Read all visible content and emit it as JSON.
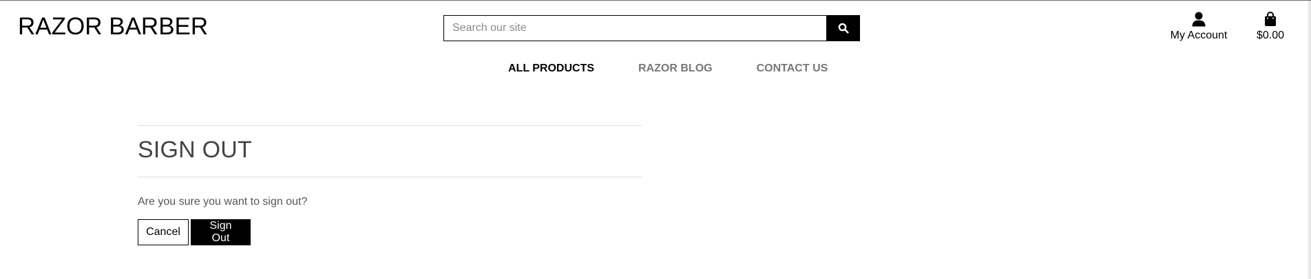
{
  "brand": {
    "name": "RAZOR BARBER"
  },
  "search": {
    "placeholder": "Search our site"
  },
  "account": {
    "label": "My Account"
  },
  "bag": {
    "total": "$0.00"
  },
  "nav": {
    "items": [
      {
        "label": "ALL PRODUCTS",
        "active": true
      },
      {
        "label": "RAZOR BLOG",
        "active": false
      },
      {
        "label": "CONTACT US",
        "active": false
      }
    ]
  },
  "main": {
    "title": "SIGN OUT",
    "message": "Are you sure you want to sign out?",
    "cancel_label": "Cancel",
    "signout_label": "Sign Out"
  },
  "icons": {
    "search": "search-icon",
    "account": "user-icon",
    "bag": "shopping-bag-icon"
  },
  "colors": {
    "primary": "#000000",
    "nav_inactive": "#777777",
    "title": "#444444",
    "text_muted": "#555555"
  }
}
